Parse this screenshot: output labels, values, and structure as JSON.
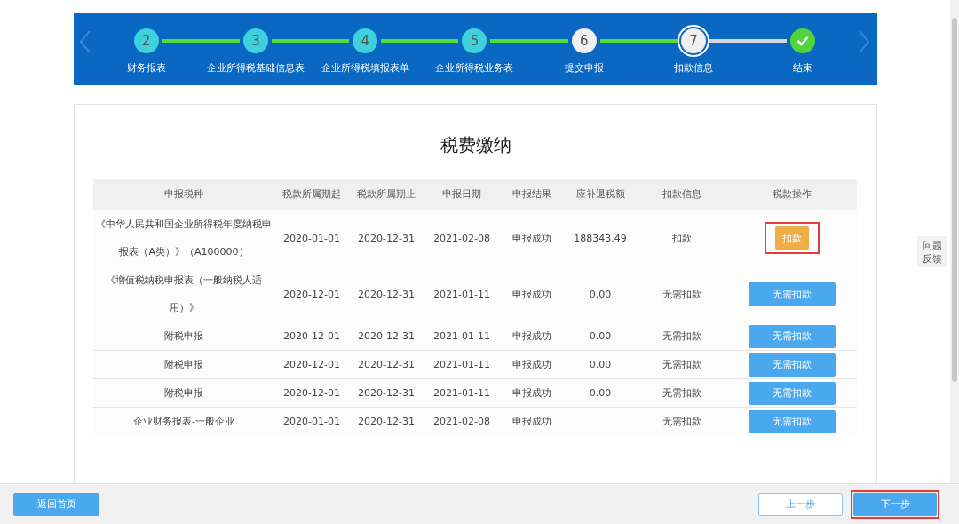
{
  "stepper": {
    "steps": [
      {
        "kind": "number",
        "number": "2",
        "label": "财务报表",
        "color": "#3ed0dc",
        "current": false
      },
      {
        "kind": "number",
        "number": "3",
        "label": "企业所得税基础信息表",
        "color": "#3ed0dc",
        "current": false
      },
      {
        "kind": "number",
        "number": "4",
        "label": "企业所得税填报表单",
        "color": "#3ed0dc",
        "current": false
      },
      {
        "kind": "number",
        "number": "5",
        "label": "企业所得税业务表",
        "color": "#3ed0dc",
        "current": false
      },
      {
        "kind": "number",
        "number": "6",
        "label": "提交申报",
        "color": "#f0f0f0",
        "current": false
      },
      {
        "kind": "number",
        "number": "7",
        "label": "扣款信息",
        "color": "#f0f0f0",
        "current": true
      },
      {
        "kind": "check",
        "label": "结束",
        "color": "#52d33a",
        "current": false
      }
    ]
  },
  "title": "税费缴纳",
  "table": {
    "columns": [
      "申报税种",
      "税款所属期起",
      "税款所属期止",
      "申报日期",
      "申报结果",
      "应补退税额",
      "扣款信息",
      "税款操作"
    ],
    "rows": [
      {
        "cells": [
          "《中华人民共和国企业所得税年度纳税申报表（A类）》（A100000）",
          "2020-01-01",
          "2020-12-31",
          "2021-02-08",
          "申报成功",
          "188343.49",
          "扣款"
        ],
        "action": {
          "label": "扣款",
          "kind": "pay",
          "highlighted": true
        }
      },
      {
        "cells": [
          "《增值税纳税申报表（一般纳税人适用）》",
          "2020-12-01",
          "2020-12-31",
          "2021-01-11",
          "申报成功",
          "0.00",
          "无需扣款"
        ],
        "action": {
          "label": "无需扣款",
          "kind": "none",
          "highlighted": false
        }
      },
      {
        "cells": [
          "附税申报",
          "2020-12-01",
          "2020-12-31",
          "2021-01-11",
          "申报成功",
          "0.00",
          "无需扣款"
        ],
        "action": {
          "label": "无需扣款",
          "kind": "none",
          "highlighted": false
        }
      },
      {
        "cells": [
          "附税申报",
          "2020-12-01",
          "2020-12-31",
          "2021-01-11",
          "申报成功",
          "0.00",
          "无需扣款"
        ],
        "action": {
          "label": "无需扣款",
          "kind": "none",
          "highlighted": false
        }
      },
      {
        "cells": [
          "附税申报",
          "2020-12-01",
          "2020-12-31",
          "2021-01-11",
          "申报成功",
          "0.00",
          "无需扣款"
        ],
        "action": {
          "label": "无需扣款",
          "kind": "none",
          "highlighted": false
        }
      },
      {
        "cells": [
          "企业财务报表-一般企业",
          "2020-01-01",
          "2020-12-31",
          "2021-02-08",
          "申报成功",
          "",
          "无需扣款"
        ],
        "action": {
          "label": "无需扣款",
          "kind": "none",
          "highlighted": false
        }
      }
    ]
  },
  "feedback": {
    "lines": [
      "问题",
      "反馈"
    ]
  },
  "footer": {
    "home_button": "返回首页",
    "prev_button": {
      "label": "上一步",
      "highlighted": false
    },
    "next_button": {
      "label": "下一步",
      "highlighted": true
    }
  }
}
